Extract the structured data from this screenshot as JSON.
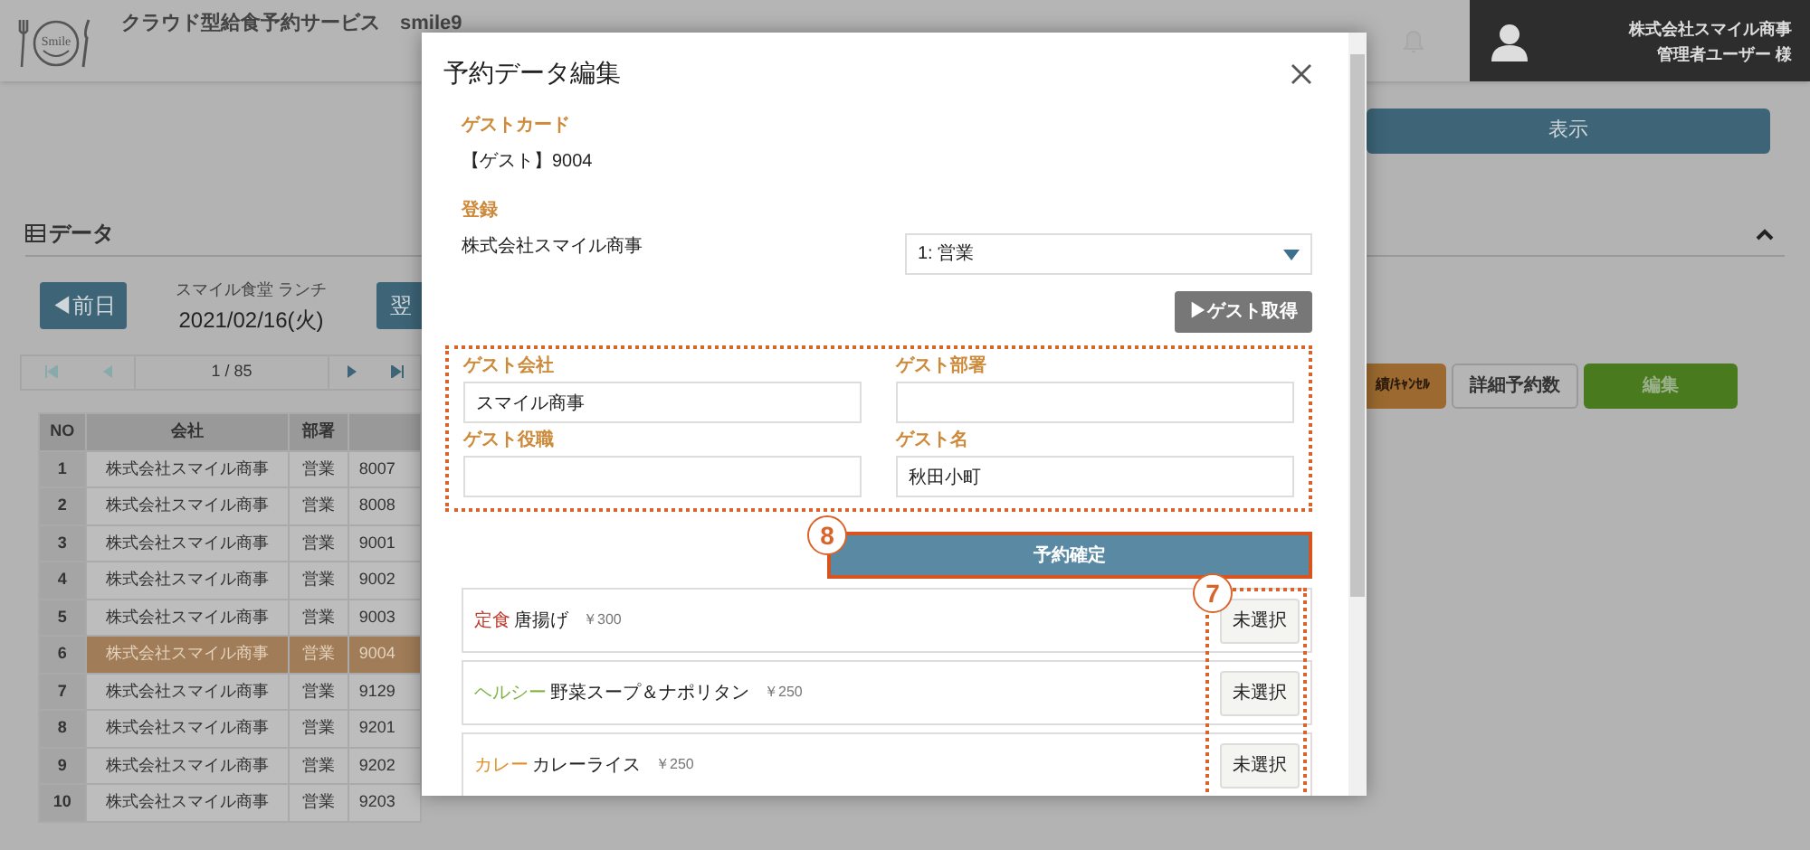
{
  "header": {
    "logo_text": "Smile",
    "title": "クラウド型給食予約サービス　smile9",
    "user_company": "株式会社スマイル商事",
    "user_name": "管理者ユーザー 様"
  },
  "show_button": "表示",
  "section_title": "データ",
  "date_nav": {
    "prev": "◀前日",
    "caption": "スマイル食堂 ランチ",
    "date": "2021/02/16(火)",
    "next": "翌"
  },
  "pager": {
    "page": "1 / 85"
  },
  "table": {
    "columns": [
      "NO",
      "会社",
      "部署"
    ],
    "rows": [
      {
        "no": "1",
        "company": "株式会社スマイル商事",
        "dept": "営業",
        "column_4": "8007",
        "selected": false
      },
      {
        "no": "2",
        "company": "株式会社スマイル商事",
        "dept": "営業",
        "column_4": "8008",
        "selected": false
      },
      {
        "no": "3",
        "company": "株式会社スマイル商事",
        "dept": "営業",
        "column_4": "9001",
        "selected": false
      },
      {
        "no": "4",
        "company": "株式会社スマイル商事",
        "dept": "営業",
        "column_4": "9002",
        "selected": false
      },
      {
        "no": "5",
        "company": "株式会社スマイル商事",
        "dept": "営業",
        "column_4": "9003",
        "selected": false
      },
      {
        "no": "6",
        "company": "株式会社スマイル商事",
        "dept": "営業",
        "column_4": "9004",
        "selected": true
      },
      {
        "no": "7",
        "company": "株式会社スマイル商事",
        "dept": "営業",
        "column_4": "9129",
        "selected": false
      },
      {
        "no": "8",
        "company": "株式会社スマイル商事",
        "dept": "営業",
        "column_4": "9201",
        "selected": false
      },
      {
        "no": "9",
        "company": "株式会社スマイル商事",
        "dept": "営業",
        "column_4": "9202",
        "selected": false
      },
      {
        "no": "10",
        "company": "株式会社スマイル商事",
        "dept": "営業",
        "column_4": "9203",
        "selected": false
      }
    ]
  },
  "action_buttons": [
    {
      "label": "績/ｷｬﾝｾﾙ",
      "kind": "orange"
    },
    {
      "label": "詳細予約数",
      "kind": "gray"
    },
    {
      "label": "編集",
      "kind": "green"
    }
  ],
  "modal": {
    "title": "予約データ編集",
    "guest_card_label": "ゲストカード",
    "guest_card": "【ゲスト】9004",
    "register_label": "登録",
    "register_company": "株式会社スマイル商事",
    "department_select": "1: 営業",
    "fetch_button": "▶ゲスト取得",
    "guest_fields": [
      {
        "label": "ゲスト会社",
        "value": "スマイル商事"
      },
      {
        "label": "ゲスト部署"
      },
      {
        "label": "ゲスト役職"
      },
      {
        "label": "ゲスト名",
        "value": "秋田小町"
      }
    ],
    "confirm_callout": "8",
    "confirm_button": "予約確定",
    "menu_callout": "7",
    "menu_items": [
      {
        "category": "定食",
        "color": "#c0392b",
        "name": "唐揚げ",
        "price": "￥300",
        "button": "未選択"
      },
      {
        "category": "ヘルシー",
        "color": "#7cb342",
        "name": "野菜スープ＆ナポリタン",
        "price": "￥250",
        "button": "未選択"
      },
      {
        "category": "カレー",
        "color": "#e0902a",
        "name": "カレーライス",
        "price": "￥250",
        "button": "未選択"
      }
    ]
  }
}
